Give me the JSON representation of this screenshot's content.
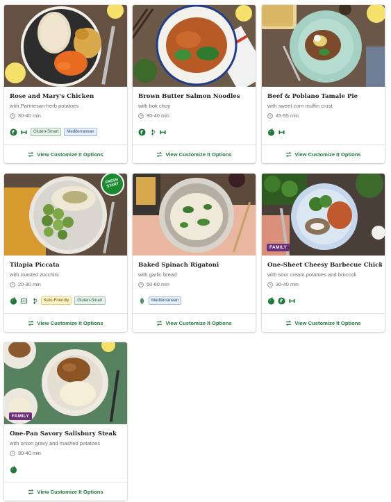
{
  "cards": [
    {
      "title": "Rose and Mary's Chicken",
      "subtitle": "with Parmesan-herb potatoes",
      "time": "30-40 min",
      "tag_icons": [
        "calorie-smart-icon",
        "protein-icon"
      ],
      "tags": [
        {
          "label": "Gluten-Smart",
          "kind": "gs"
        },
        {
          "label": "Mediterranean",
          "kind": "med"
        }
      ],
      "action": "View Customize It Options"
    },
    {
      "title": "Brown Butter Salmon Noodles",
      "subtitle": "with bok choy",
      "time": "30-40 min",
      "tag_icons": [
        "calorie-smart-icon",
        "carb-smart-icon",
        "protein-icon"
      ],
      "tags": [],
      "action": "View Customize It Options"
    },
    {
      "title": "Beef & Poblano Tamale Pie",
      "subtitle": "with sweet corn muffin crust",
      "time": "45-55 min",
      "tag_icons": [
        "apple-icon",
        "protein-icon"
      ],
      "tags": [],
      "action": "View Customize It Options"
    },
    {
      "title": "Tilapia Piccata",
      "subtitle": "with roasted zucchini",
      "time": "20-30 min",
      "tag_icons": [
        "apple-icon",
        "dish-icon",
        "carb-smart-icon"
      ],
      "tags": [
        {
          "label": "Keto-Friendly",
          "kind": "keto"
        },
        {
          "label": "Gluten-Smart",
          "kind": "gs"
        }
      ],
      "action": "View Customize It Options",
      "badge_fresh": "FRESH START"
    },
    {
      "title": "Baked Spinach Rigatoni",
      "subtitle": "with garlic bread",
      "time": "50-60 min",
      "tag_icons": [
        "veggie-icon"
      ],
      "tags": [
        {
          "label": "Mediterranean",
          "kind": "med"
        }
      ],
      "action": "View Customize It Options"
    },
    {
      "title": "One-Sheet Cheesy Barbecue Chicken",
      "subtitle": "with sour cream potatoes and broccoli",
      "time": "30-40 min",
      "tag_icons": [
        "apple-icon",
        "calorie-smart-icon",
        "protein-icon"
      ],
      "tags": [],
      "action": "View Customize It Options",
      "badge_family": "FAMILY"
    },
    {
      "title": "One-Pan Savory Salisbury Steak",
      "subtitle": "with onion gravy and mashed potatoes",
      "time": "30-40 min",
      "tag_icons": [
        "apple-icon"
      ],
      "tags": [],
      "action": "View Customize It Options",
      "badge_family": "FAMILY"
    }
  ],
  "colors": {
    "accent_green": "#1f7a3a",
    "family_purple": "#6b2f7a",
    "fresh_green": "#1a8a2f"
  }
}
